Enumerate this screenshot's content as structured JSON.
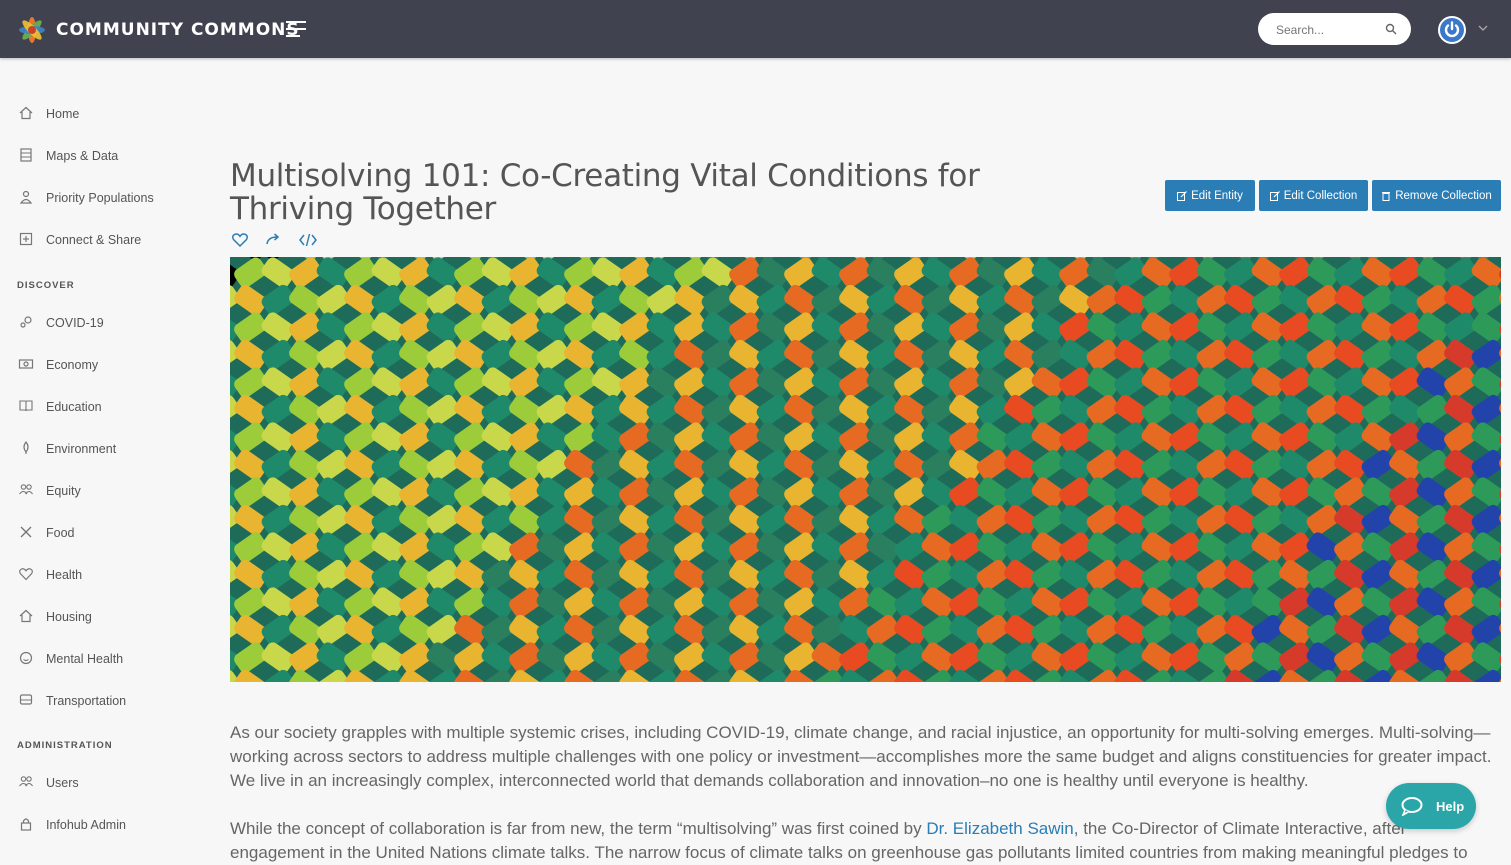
{
  "header": {
    "brand": "COMMUNITY COMMONS",
    "search_placeholder": "Search..."
  },
  "sidebar": {
    "main_items": [
      {
        "label": "Home",
        "icon": "home-icon"
      },
      {
        "label": "Maps & Data",
        "icon": "maps-icon"
      },
      {
        "label": "Priority Populations",
        "icon": "people-icon"
      },
      {
        "label": "Connect & Share",
        "icon": "plus-square-icon"
      }
    ],
    "discover_label": "DISCOVER",
    "discover_items": [
      {
        "label": "COVID-19",
        "icon": "covid-icon"
      },
      {
        "label": "Economy",
        "icon": "money-icon"
      },
      {
        "label": "Education",
        "icon": "book-icon"
      },
      {
        "label": "Environment",
        "icon": "leaf-icon"
      },
      {
        "label": "Equity",
        "icon": "users-icon"
      },
      {
        "label": "Food",
        "icon": "utensils-icon"
      },
      {
        "label": "Health",
        "icon": "heart-icon"
      },
      {
        "label": "Housing",
        "icon": "house-icon"
      },
      {
        "label": "Mental Health",
        "icon": "smile-icon"
      },
      {
        "label": "Transportation",
        "icon": "bus-icon"
      }
    ],
    "admin_label": "ADMINISTRATION",
    "admin_items": [
      {
        "label": "Users",
        "icon": "users-icon"
      },
      {
        "label": "Infohub Admin",
        "icon": "lock-icon"
      }
    ]
  },
  "main": {
    "title": "Multisolving 101: Co-Creating Vital Conditions for Thriving Together",
    "buttons": {
      "edit_entity": "Edit Entity",
      "edit_collection": "Edit Collection",
      "remove_collection": "Remove Collection"
    },
    "paragraph1": "As our society grapples with multiple systemic crises, including COVID-19, climate change, and racial injustice, an opportunity for multi-solving emerges. Multi-solving—working across sectors to address multiple challenges with one policy or investment—accomplishes more the same budget and aligns constituencies for greater impact. We live in an increasingly complex, interconnected world that demands collaboration and innovation–no one is healthy until everyone is healthy.",
    "paragraph2_before": "While the concept of collaboration is far from new, the term “multisolving” was first coined by ",
    "paragraph2_link": "Dr. Elizabeth Sawin",
    "paragraph2_after": ", the Co-Director of Climate Interactive, after engagement in the United Nations climate talks. The narrow focus of climate talks on greenhouse gas pollutants limited countries from making meaningful pledges to"
  },
  "help": {
    "label": "Help"
  },
  "colors": {
    "topbar": "#40424f",
    "accent": "#2a7db5",
    "help": "#2aa6a8"
  }
}
